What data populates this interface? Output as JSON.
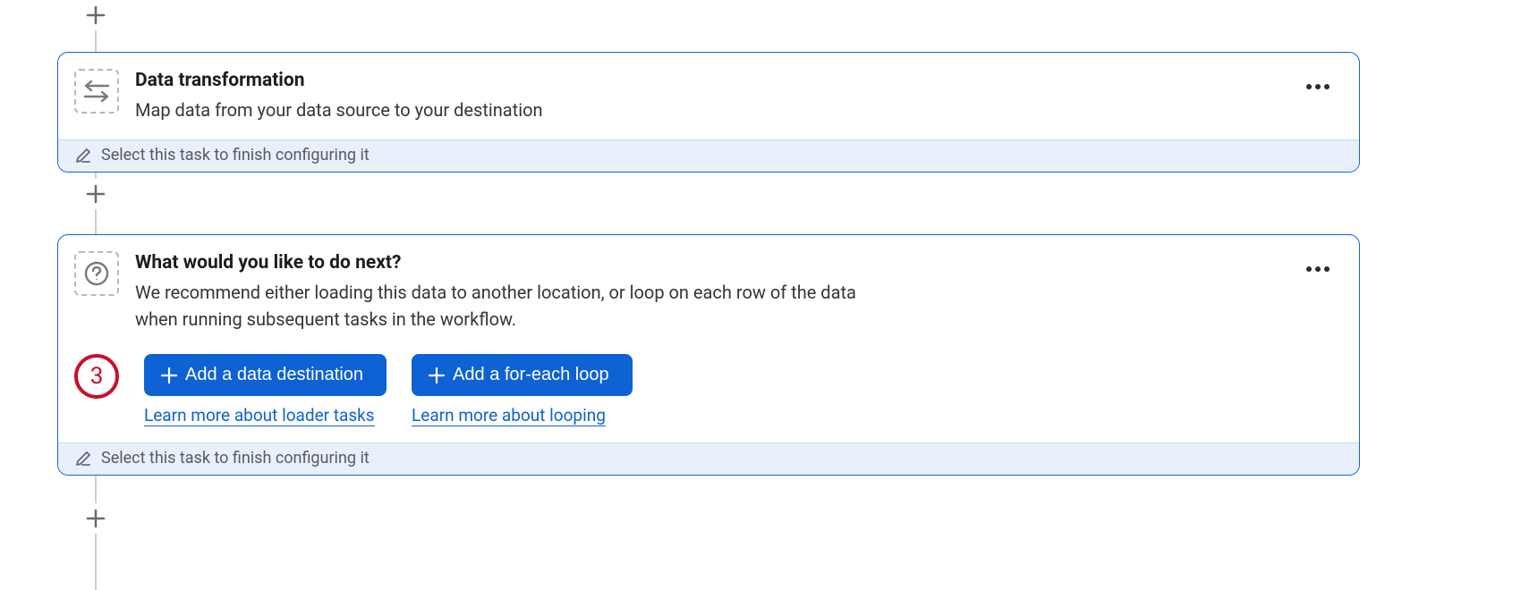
{
  "card1": {
    "title": "Data transformation",
    "desc": "Map data from your data source to your destination",
    "footer": "Select this task to finish configuring it"
  },
  "card2": {
    "title": "What would you like to do next?",
    "desc": "We recommend either loading this data to another location, or loop on each row of the data when running subsequent tasks in the workflow.",
    "footer": "Select this task to finish configuring it",
    "annotation": "3",
    "actions": {
      "dest_btn": "Add a data destination",
      "dest_link": "Learn more about loader tasks",
      "loop_btn": "Add a for-each loop",
      "loop_link": "Learn more about looping"
    }
  }
}
